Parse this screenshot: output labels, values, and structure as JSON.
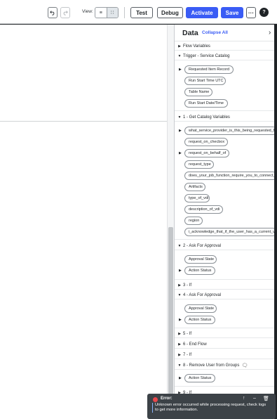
{
  "toolbar": {
    "view_label": "View:",
    "test_label": "Test",
    "debug_label": "Debug",
    "activate_label": "Activate",
    "save_label": "Save",
    "more_label": "···",
    "help_label": "?",
    "view_options": [
      "≡",
      "∷"
    ]
  },
  "panel": {
    "title": "Data",
    "collapse_all": "Collapse All",
    "close_icon": "›"
  },
  "sections": {
    "flow_variables": "Flow Variables",
    "trigger": "Trigger - Service Catalog",
    "get_catalog": "1 - Get Catalog Variables",
    "ask_approval_2": "2 - Ask For Approval",
    "if_3": "3 - If",
    "ask_approval_4": "4 - Ask For Approval",
    "if_5": "5 - If",
    "end_flow_6": "6 - End Flow",
    "if_7": "7 - If",
    "remove_user_8": "8 - Remove User from Groups",
    "if_9": "9 - If"
  },
  "pills": {
    "requested_item_record": "Requested Item Record",
    "run_start_time_utc": "Run Start Time UTC",
    "table_name": "Table Name",
    "run_start_datetime": "Run Start Date/Time",
    "what_service_provider": "what_service_provider_is_this_being_requested_f",
    "request_on_checkbox": "request_on_checbox",
    "request_on_behalf_of": "request_on_behalf_of",
    "request_type": "request_type",
    "does_your_job_function": "does_your_job_function_require_you_to_connect_",
    "artifacts": "Artifacts",
    "type_of_vdi": "type_of_vdi",
    "description_of_vdi": "description_of_vdi",
    "region": "region",
    "i_acknowledge": "i_acknowledge_that_if_the_user_has_a_current_vd",
    "approval_state_2": "Approval State",
    "action_status_2": "Action Status",
    "approval_state_4": "Approval State",
    "action_status_4": "Action Status",
    "action_status_8": "Action Status"
  },
  "toast": {
    "title": "Error:",
    "message": "Unknown error occurred while processing request, check logs to get more information."
  }
}
